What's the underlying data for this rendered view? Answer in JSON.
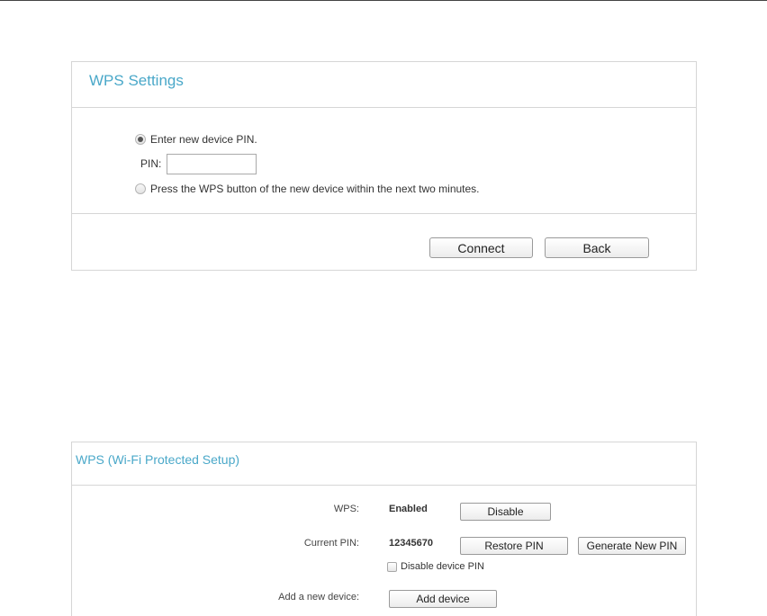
{
  "wps_settings": {
    "title": "WPS Settings",
    "option_pin_label": "Enter new device PIN.",
    "option_pin_selected": true,
    "pin_label": "PIN:",
    "pin_value": "",
    "option_pbc_label": "Press the WPS button of the new device within the next two minutes.",
    "option_pbc_selected": false,
    "connect_label": "Connect",
    "back_label": "Back"
  },
  "wps_setup": {
    "title": "WPS (Wi-Fi Protected Setup)",
    "wps_label": "WPS:",
    "wps_status": "Enabled",
    "disable_label": "Disable",
    "current_pin_label": "Current PIN:",
    "current_pin_value": "12345670",
    "restore_pin_label": "Restore PIN",
    "generate_pin_label": "Generate New PIN",
    "disable_device_pin_label": "Disable device PIN",
    "disable_device_pin_checked": false,
    "add_device_label": "Add a new device:",
    "add_device_button": "Add device"
  },
  "colors": {
    "title": "#4aa8c9",
    "border": "#d6d6d6"
  }
}
